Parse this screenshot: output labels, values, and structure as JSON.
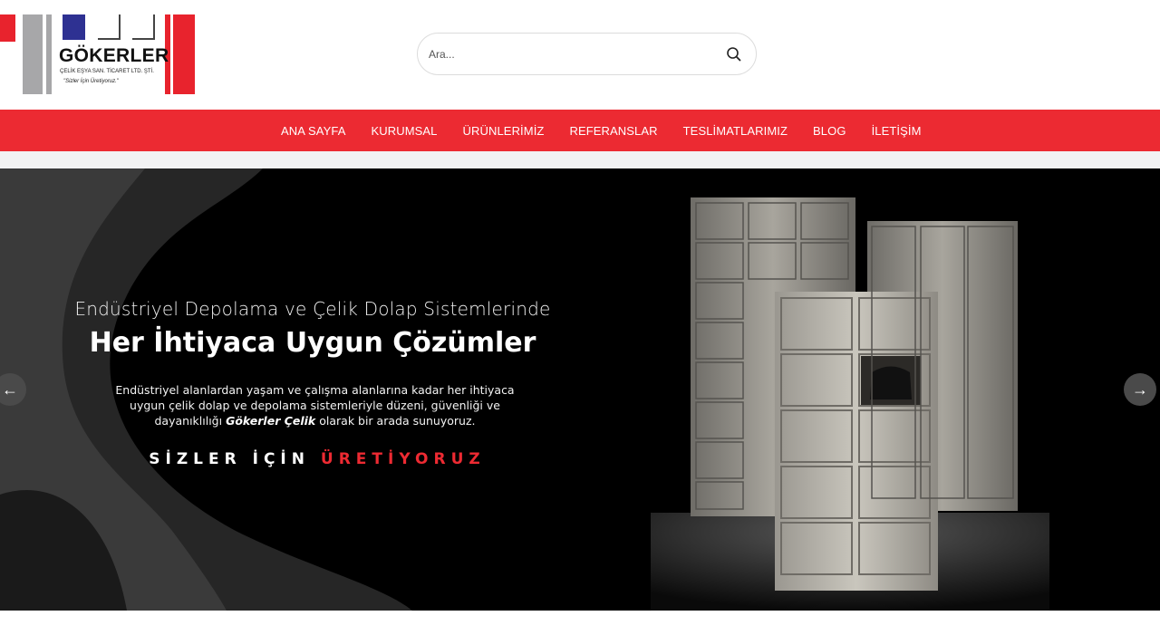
{
  "header": {
    "brand": "GÖKERLER",
    "company": "ÇELİK EŞYA SAN. TİCARET LTD. ŞTİ.",
    "slogan": "\"Sizler İçin Üretiyoruz.\""
  },
  "search": {
    "placeholder": "Ara...",
    "value": ""
  },
  "nav": {
    "items": [
      {
        "label": "ANA SAYFA"
      },
      {
        "label": "KURUMSAL"
      },
      {
        "label": "ÜRÜNLERİMİZ"
      },
      {
        "label": "REFERANSLAR"
      },
      {
        "label": "TESLİMATLARIMIZ"
      },
      {
        "label": "BLOG"
      },
      {
        "label": "İLETİŞİM"
      }
    ]
  },
  "hero": {
    "kicker": "Endüstriyel Depolama ve Çelik Dolap Sistemlerinde",
    "headline": "Her İhtiyaca Uygun Çözümler",
    "desc_part1": "Endüstriyel alanlardan yaşam ve çalışma alanlarına kadar her ihtiyaca uygun çelik dolap ve depolama sistemleriyle düzeni, güvenliği ve dayanıklılığı",
    "desc_bold": "Gökerler Çelik",
    "desc_part2": "olarak bir arada sunuyoruz.",
    "tagline_white": "SİZLER İÇİN",
    "tagline_red": "ÜRETİYORUZ",
    "prev_icon": "arrow-left-icon",
    "next_icon": "arrow-right-icon",
    "prev_glyph": "←",
    "next_glyph": "→",
    "product_label": "Gökerler"
  },
  "colors": {
    "brand_red": "#ec2a32",
    "logo_blue": "#2e3192",
    "logo_gray": "#a7a7a9",
    "hero_bg": "#000000"
  }
}
